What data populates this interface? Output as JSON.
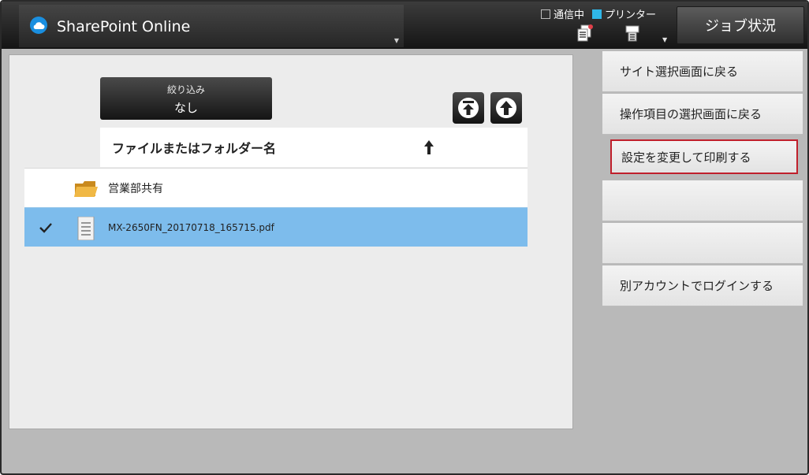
{
  "header": {
    "app_title": "SharePoint Online",
    "status": [
      {
        "label": "通信中",
        "active": false
      },
      {
        "label": "プリンター",
        "active": true
      }
    ],
    "job_status_label": "ジョブ状況"
  },
  "filter": {
    "label": "絞り込み",
    "value": "なし"
  },
  "list": {
    "column_header": "ファイルまたはフォルダー名",
    "rows": [
      {
        "type": "folder",
        "name": "営業部共有",
        "selected": false
      },
      {
        "type": "file",
        "name": "MX-2650FN_20170718_165715.pdf",
        "selected": true
      }
    ]
  },
  "menu": {
    "items": [
      {
        "label": "サイト選択画面に戻る"
      },
      {
        "label": "操作項目の選択画面に戻る"
      },
      {
        "label": "設定を変更して印刷する",
        "highlighted": true
      },
      {
        "label": ""
      },
      {
        "label": ""
      },
      {
        "label": "別アカウントでログインする"
      }
    ]
  },
  "colors": {
    "selected_row": "#7dbcec",
    "highlight_border": "#c0202c",
    "printer_status": "#2fb7e8"
  }
}
